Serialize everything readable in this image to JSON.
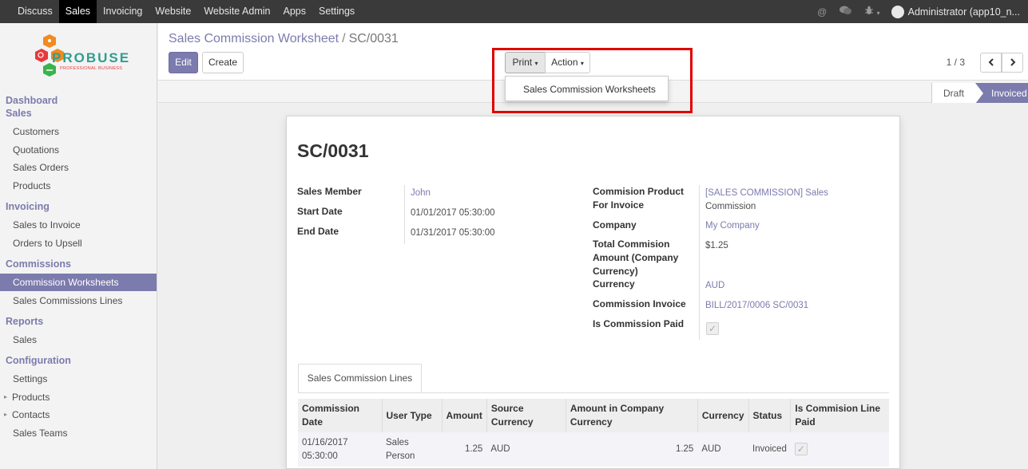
{
  "topbar": {
    "menu": [
      "Discuss",
      "Sales",
      "Invoicing",
      "Website",
      "Website Admin",
      "Apps",
      "Settings"
    ],
    "active": "Sales",
    "user": "Administrator (app10_n..."
  },
  "logo": {
    "name": "PROBUSE",
    "tagline": "PROFESSIONAL BUSINESS"
  },
  "sidebar": {
    "dashboard": "Dashboard",
    "sales_heading": "Sales",
    "sales_items": [
      "Customers",
      "Quotations",
      "Sales Orders",
      "Products"
    ],
    "invoicing_heading": "Invoicing",
    "invoicing_items": [
      "Sales to Invoice",
      "Orders to Upsell"
    ],
    "commissions_heading": "Commissions",
    "commissions_items": [
      "Commission Worksheets",
      "Sales Commissions Lines"
    ],
    "reports_heading": "Reports",
    "reports_items": [
      "Sales"
    ],
    "configuration_heading": "Configuration",
    "configuration_items": [
      "Settings",
      "Products",
      "Contacts",
      "Sales Teams"
    ]
  },
  "breadcrumb": {
    "parent": "Sales Commission Worksheet",
    "separator": "/",
    "current": "SC/0031"
  },
  "buttons": {
    "edit": "Edit",
    "create": "Create",
    "print": "Print",
    "action": "Action"
  },
  "print_menu": {
    "option": "Sales Commission Worksheets"
  },
  "pager": {
    "value": "1 / 3"
  },
  "status": {
    "draft": "Draft",
    "invoiced": "Invoiced"
  },
  "record": {
    "name": "SC/0031",
    "sales_member_label": "Sales Member",
    "sales_member": "John",
    "start_date_label": "Start Date",
    "start_date": "01/01/2017 05:30:00",
    "end_date_label": "End Date",
    "end_date": "01/31/2017 05:30:00",
    "commission_product_label": "Commision Product For Invoice",
    "commission_product_1": "[SALES COMMISSION] Sales",
    "commission_product_2": "Commission",
    "company_label": "Company",
    "company": "My Company",
    "total_label": "Total Commision Amount (Company Currency)",
    "total": "$1.25",
    "currency_label": "Currency",
    "currency": "AUD",
    "invoice_label": "Commission Invoice",
    "invoice": "BILL/2017/0006 SC/0031",
    "paid_label": "Is Commission Paid",
    "paid": true
  },
  "lines_tab": "Sales Commission Lines",
  "lines_table": {
    "headers": [
      "Commission Date",
      "User Type",
      "Amount",
      "Source Currency",
      "Amount in Company Currency",
      "Currency",
      "Status",
      "Is Commision Line Paid"
    ],
    "rows": [
      [
        "01/16/2017 05:30:00",
        "Sales Person",
        "1.25",
        "AUD",
        "1.25",
        "AUD",
        "Invoiced",
        ""
      ]
    ]
  }
}
